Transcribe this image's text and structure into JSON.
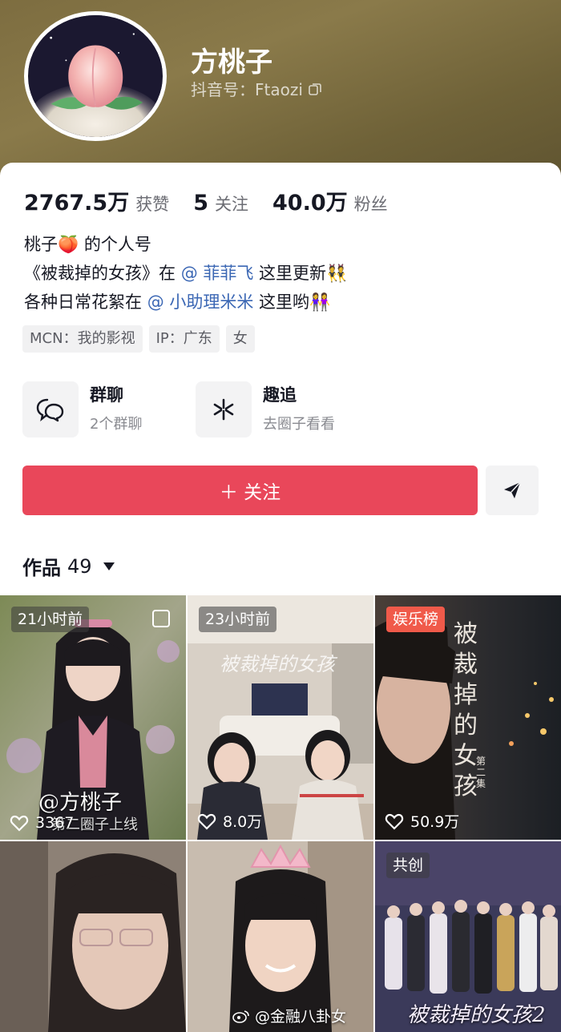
{
  "profile": {
    "nickname": "方桃子",
    "douyin_id": "抖音号：Ftaozi",
    "avatar_icon": "peach-avatar"
  },
  "stats": [
    {
      "value": "2767.5万",
      "label": "获赞"
    },
    {
      "value": "5",
      "label": "关注"
    },
    {
      "value": "40.0万",
      "label": "粉丝"
    }
  ],
  "bio": {
    "line1_a": "桃子",
    "line1_emoji": "🍑",
    "line1_b": " 的个人号",
    "line2_a": "《被裁掉的女孩》在 ",
    "line2_mention": "@ 菲菲飞",
    "line2_b": " 这里更新",
    "line2_emoji": "👯",
    "line3_a": "各种日常花絮在 ",
    "line3_mention": "@ 小助理米米",
    "line3_b": " 这里哟",
    "line3_emoji": "👭"
  },
  "tags": [
    "MCN：我的影视",
    "IP：广东",
    "女"
  ],
  "entries": [
    {
      "title": "群聊",
      "subtitle": "2个群聊",
      "icon": "chat-bubbles-icon"
    },
    {
      "title": "趣追",
      "subtitle": "去圈子看看",
      "icon": "sparkle-icon"
    }
  ],
  "follow_button": "＋ 关注",
  "works_tab": {
    "label": "作品",
    "count": "49"
  },
  "videos": [
    {
      "badge": "21小时前",
      "likes": "3367"
    },
    {
      "badge": "23小时前",
      "likes": "8.0万"
    },
    {
      "badge": "娱乐榜",
      "likes": "50.9万"
    },
    {
      "badge": "",
      "likes": ""
    },
    {
      "badge": "",
      "likes": ""
    },
    {
      "badge": "共创",
      "likes": ""
    }
  ],
  "video_texts": {
    "v1_overlay1": "@方桃子",
    "v1_overlay2": "第二圈子上线",
    "v2_overlay": "被裁掉的女孩",
    "v3_title": "被裁掉的女孩",
    "v3_sub": "第二集",
    "v6_title": "被裁掉的女孩2"
  },
  "watermark": "@金融八卦女",
  "colors": {
    "accent": "#e9475a",
    "mention": "#3b67b4"
  }
}
